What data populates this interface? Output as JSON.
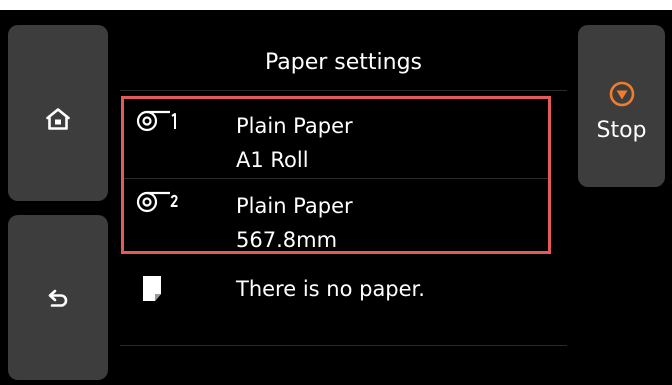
{
  "header": {
    "title": "Paper settings"
  },
  "nav": {
    "home_icon": "home-icon",
    "back_icon": "back-arrow-icon"
  },
  "stop": {
    "label": "Stop",
    "icon": "stop-icon",
    "color": "#f07d2b"
  },
  "paper_sources": [
    {
      "icon": "roll-paper-1-icon",
      "type": "Plain Paper",
      "size": "A1 Roll"
    },
    {
      "icon": "roll-paper-2-icon",
      "type": "Plain Paper",
      "size": "567.8mm"
    },
    {
      "icon": "cut-sheet-icon",
      "message": "There is no paper."
    }
  ],
  "colors": {
    "background": "#000000",
    "button": "#3d3d3d",
    "highlight": "#e35a5a",
    "text": "#ffffff"
  }
}
